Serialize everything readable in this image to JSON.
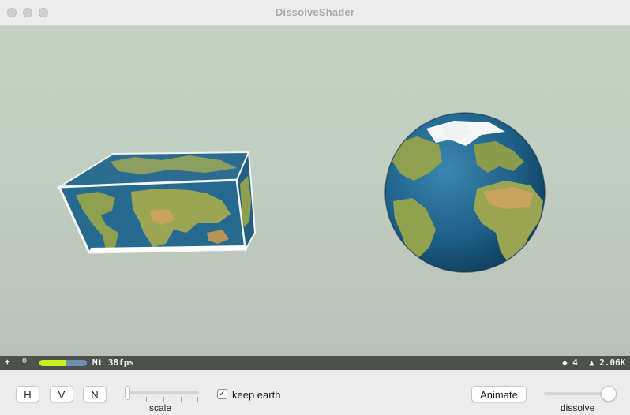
{
  "window": {
    "title": "DissolveShader"
  },
  "stats": {
    "plus_symbol": "+",
    "gear_symbol": "⚙",
    "performance_level": 0.55,
    "renderer_fps": "Mt 38fps",
    "nodes": "◆ 4",
    "triangles": "▲ 2.06K"
  },
  "controls": {
    "buttons": {
      "h": "H",
      "v": "V",
      "n": "N",
      "animate": "Animate"
    },
    "scale_label": "scale",
    "scale_value": 0.0,
    "checkbox_checked": true,
    "checkbox_mark": "✓",
    "keep_earth_label": "keep earth",
    "dissolve_label": "dissolve",
    "dissolve_value": 1.0
  },
  "scene": {
    "objects": [
      "earth-box",
      "earth-sphere"
    ],
    "colors": {
      "ocean": "#1f5c82",
      "land": "#8a9a48",
      "desert": "#c9a25f",
      "ice": "#f7f7f7"
    }
  }
}
